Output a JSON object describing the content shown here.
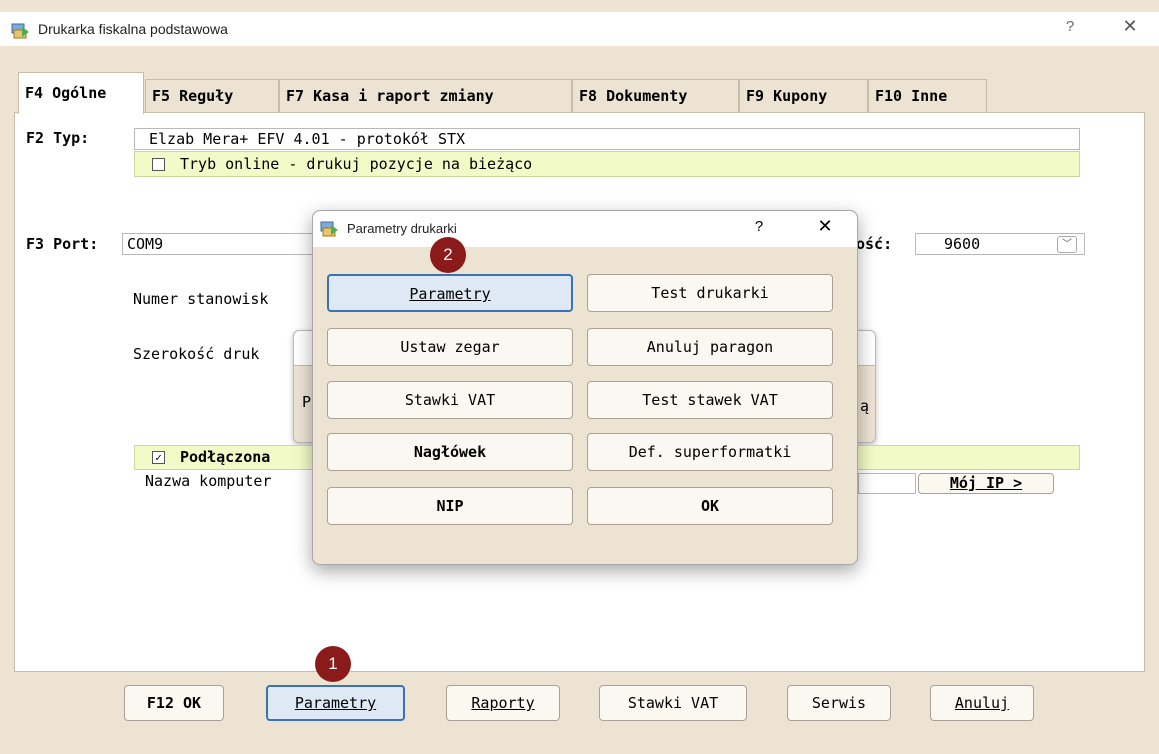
{
  "window": {
    "title": "Drukarka fiskalna podstawowa",
    "help": "?",
    "close": "✕"
  },
  "tabs": [
    {
      "label": "F4 Ogólne"
    },
    {
      "label": "F5 Reguły"
    },
    {
      "label": "F7 Kasa i raport zmiany"
    },
    {
      "label": "F8 Dokumenty"
    },
    {
      "label": "F9 Kupony"
    },
    {
      "label": "F10 Inne"
    }
  ],
  "form": {
    "type_label": "F2 Typ:",
    "type_value": "Elzab Mera+ EFV 4.01 - protokół STX",
    "online_label": "Tryb online - drukuj pozycje na bieżąco",
    "online_checked": false,
    "port_label": "F3 Port:",
    "port_value": "COM9",
    "speed_label_partial": "ość:",
    "speed_value": "9600",
    "workstation_label_partial": "Numer stanowisk",
    "width_label_partial": "Szerokość druk",
    "connected_label": "Podłączona",
    "connected_checked": true,
    "computer_label_partial": "Nazwa komputer",
    "my_ip_button": "Mój IP >",
    "hidden_dialog_letter_left": "P",
    "hidden_dialog_letter_right": "ą"
  },
  "bottom_buttons": {
    "ok": "F12 OK",
    "params": "Parametry",
    "reports": "Raporty",
    "vat": "Stawki VAT",
    "service": "Serwis",
    "cancel": "Anuluj"
  },
  "dialog": {
    "title": "Parametry drukarki",
    "help": "?",
    "close": "✕",
    "buttons": {
      "params": "Parametry",
      "test_printer": "Test drukarki",
      "set_clock": "Ustaw zegar",
      "cancel_receipt": "Anuluj paragon",
      "vat_rates": "Stawki VAT",
      "test_vat": "Test stawek VAT",
      "header": "Nagłówek",
      "superformat": "Def. superformatki",
      "nip": "NIP",
      "ok": "OK"
    }
  },
  "markers": {
    "first": "1",
    "second": "2"
  },
  "colors": {
    "window_bg": "#ece3d3",
    "highlight_field": "#f2fbc8",
    "focused_button_border": "#3a73b5",
    "marker": "#8b1a1a"
  }
}
